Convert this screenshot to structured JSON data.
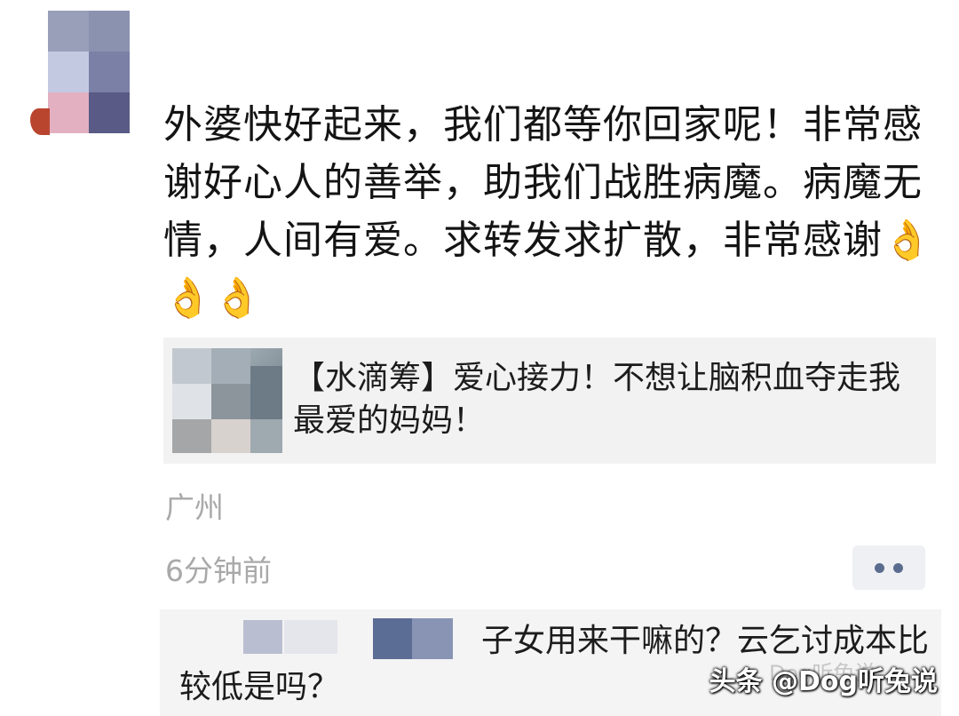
{
  "post": {
    "text": "外婆快好起来，我们都等你回家呢！非常感谢好心人的善举，助我们战胜病魔。病魔无情，人间有爱。求转发求扩散，非常感谢👌👌👌",
    "location": "广州",
    "time": "6分钟前",
    "more_icon": "more-dots-icon"
  },
  "share_card": {
    "title": "【水滴筹】爱心接力！不想让脑积血夺走我最爱的妈妈！"
  },
  "comment": {
    "text": "子女用来干嘛的？云乞讨成本比较低是吗？"
  },
  "watermark": {
    "text": "头条 @Dog听兔说",
    "faint_text": "Dog听兔说"
  },
  "colors": {
    "meta_gray": "#a9a9a9",
    "link_blue": "#5a6c8e"
  }
}
